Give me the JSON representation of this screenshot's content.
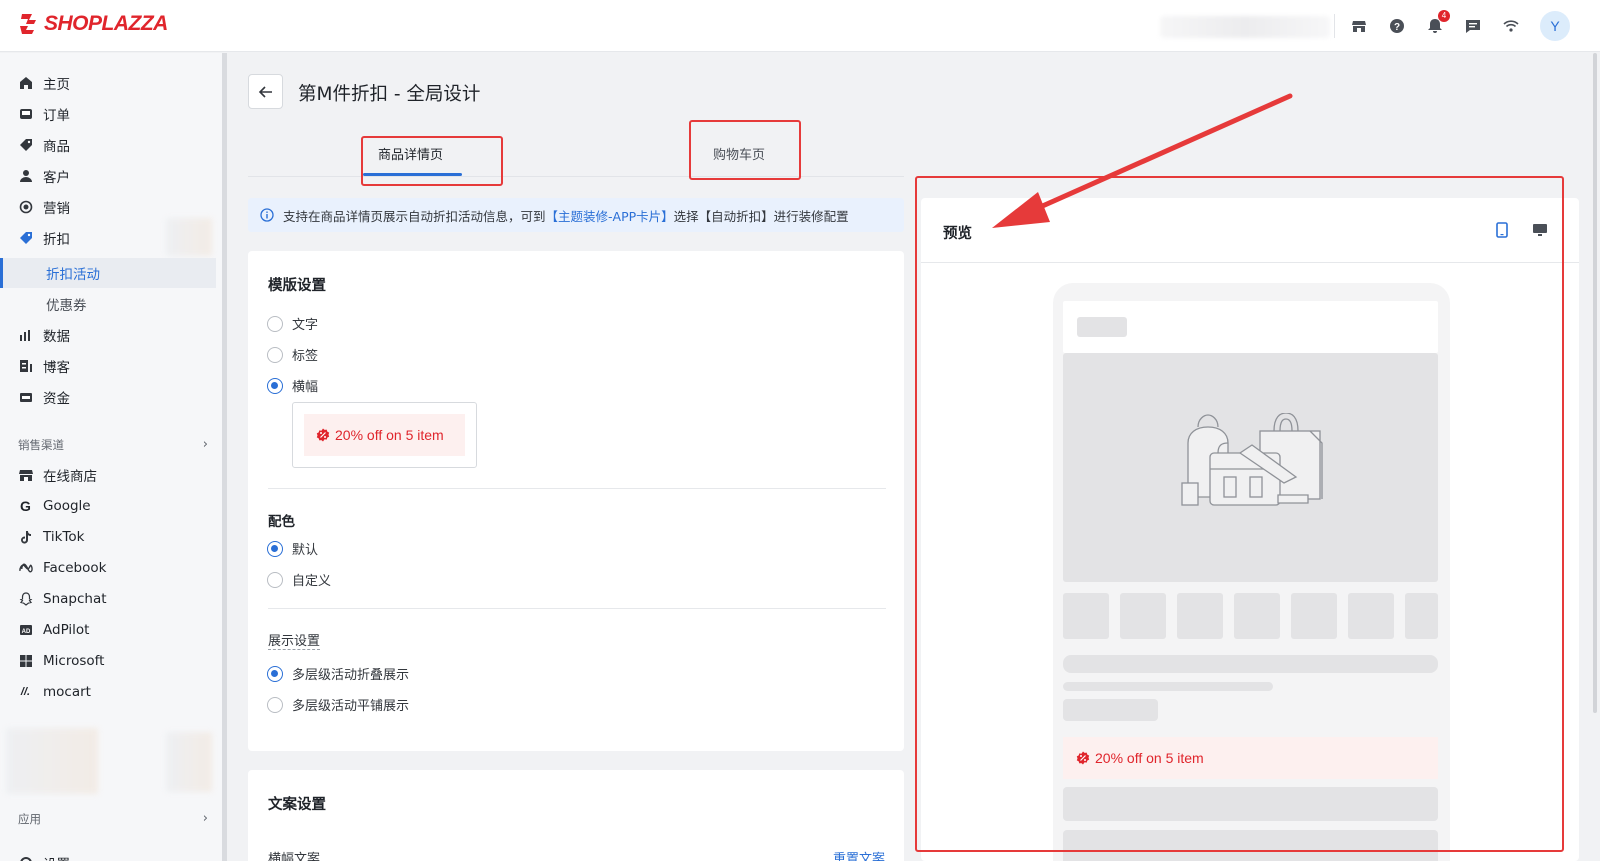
{
  "topbar": {
    "brand": "SHOPLAZZA",
    "notification_count": "4",
    "avatar_initial": "Y"
  },
  "sidebar": {
    "items": [
      {
        "label": "主页",
        "icon": "home-icon"
      },
      {
        "label": "订单",
        "icon": "inbox-icon"
      },
      {
        "label": "商品",
        "icon": "tag-icon"
      },
      {
        "label": "客户",
        "icon": "user-icon"
      },
      {
        "label": "营销",
        "icon": "target-icon"
      },
      {
        "label": "折扣",
        "icon": "discount-icon"
      },
      {
        "label": "折扣活动",
        "sub": true,
        "active": true
      },
      {
        "label": "优惠券",
        "sub": true
      },
      {
        "label": "数据",
        "icon": "bar-chart-icon"
      },
      {
        "label": "博客",
        "icon": "blog-icon"
      },
      {
        "label": "资金",
        "icon": "wallet-icon"
      }
    ],
    "sales_channels_label": "销售渠道",
    "channels": [
      {
        "label": "在线商店",
        "icon": "store-icon"
      },
      {
        "label": "Google",
        "icon": "google-icon"
      },
      {
        "label": "TikTok",
        "icon": "tiktok-icon"
      },
      {
        "label": "Facebook",
        "icon": "meta-icon"
      },
      {
        "label": "Snapchat",
        "icon": "snapchat-icon"
      },
      {
        "label": "AdPilot",
        "icon": "adpilot-icon"
      },
      {
        "label": "Microsoft",
        "icon": "microsoft-icon"
      },
      {
        "label": "mocart",
        "icon": "mocart-icon"
      }
    ],
    "apps_label": "应用",
    "settings_label": "设置"
  },
  "page": {
    "title": "第M件折扣 - 全局设计",
    "tabs": [
      "商品详情页",
      "购物车页"
    ],
    "info": {
      "prefix": "支持在商品详情页展示自动折扣活动信息，可到",
      "link": "【主题装修-APP卡片】",
      "suffix": "选择【自动折扣】进行装修配置"
    }
  },
  "template_settings": {
    "title": "模版设置",
    "options": [
      "文字",
      "标签",
      "横幅"
    ],
    "selected": "横幅",
    "promo_text": "20% off on 5 item",
    "color_title": "配色",
    "color_options": [
      "默认",
      "自定义"
    ],
    "color_selected": "默认",
    "display_title": "展示设置",
    "display_options": [
      "多层级活动折叠展示",
      "多层级活动平铺展示"
    ],
    "display_selected": "多层级活动折叠展示"
  },
  "copy_settings": {
    "title": "文案设置",
    "banner_copy_label": "横幅文案",
    "reset_label": "重置文案"
  },
  "preview": {
    "title": "预览",
    "promo_text": "20% off on 5 item"
  },
  "colors": {
    "accent": "#2a6fd6",
    "brand": "#e0252c",
    "annotation": "#e63a3a"
  }
}
